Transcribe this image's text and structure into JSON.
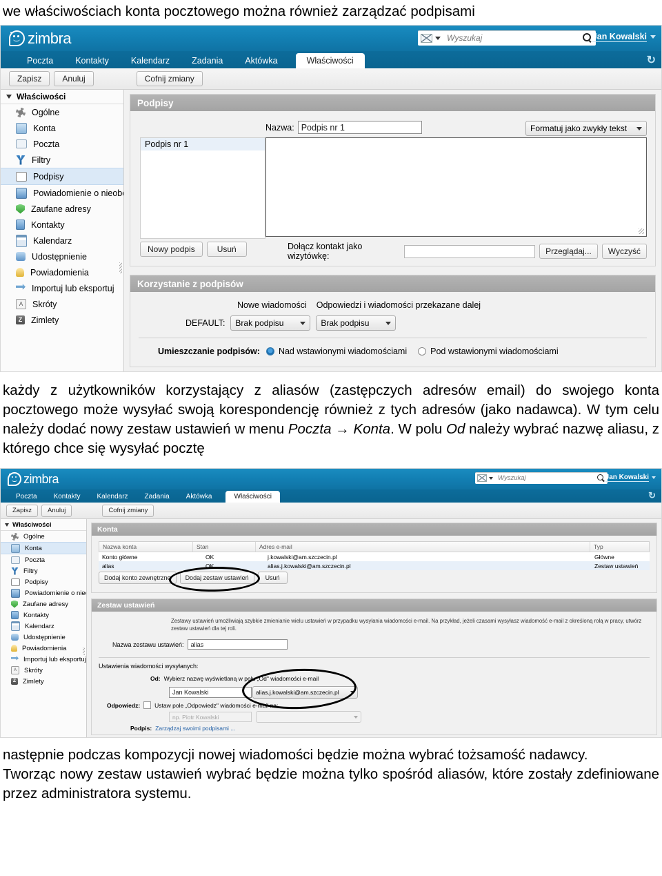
{
  "document": {
    "heading": "we właściwościach konta pocztowego można również zarządzać podpisami",
    "paragraph_middle": "każdy z użytkowników korzystający z aliasów (zastępczych adresów email) do swojego konta pocztowego może wysyłać swoją korespondencję również z tych adresów (jako nadawca). W tym celu należy dodać nowy zestaw ustawień w  menu ",
    "paragraph_middle_italic_1": "Poczta → Konta",
    "paragraph_middle_cont": ". W polu ",
    "paragraph_middle_italic_2": "Od",
    "paragraph_middle_end": " należy wybrać nazwę aliasu, z którego chce się wysyłać pocztę",
    "paragraph_bottom_1": "następnie podczas kompozycji nowej wiadomości będzie można wybrać tożsamość nadawcy.",
    "paragraph_bottom_2": "Tworząc nowy zestaw ustawień wybrać będzie można tylko spośród aliasów, które zostały zdefiniowane przez administratora systemu."
  },
  "colors": {
    "brand_blue": "#1380b4",
    "tabbar_blue": "#0a6490",
    "panel_header_gray": "#a9a9a9",
    "selected_row_blue": "#e8f0f9",
    "link_blue": "#2663a8"
  },
  "shot1": {
    "app_name": "zimbra",
    "search": {
      "placeholder": "Wyszukaj",
      "value": ""
    },
    "user": "Jan Kowalski",
    "tabs": [
      {
        "label": "Poczta",
        "active": false
      },
      {
        "label": "Kontakty",
        "active": false
      },
      {
        "label": "Kalendarz",
        "active": false
      },
      {
        "label": "Zadania",
        "active": false
      },
      {
        "label": "Aktówka",
        "active": false
      },
      {
        "label": "Właściwości",
        "active": true
      }
    ],
    "toolbar": {
      "save": "Zapisz",
      "cancel": "Anuluj",
      "undo": "Cofnij zmiany"
    },
    "sidebar": {
      "title": "Właściwości",
      "items": [
        {
          "label": "Ogólne",
          "icon": "gear-icon",
          "selected": false
        },
        {
          "label": "Konta",
          "icon": "accounts-icon",
          "selected": false
        },
        {
          "label": "Poczta",
          "icon": "mail-icon",
          "selected": false
        },
        {
          "label": "Filtry",
          "icon": "filter-icon",
          "selected": false
        },
        {
          "label": "Podpisy",
          "icon": "signature-icon",
          "selected": true
        },
        {
          "label": "Powiadomienie o nieobe",
          "icon": "out-of-office-icon",
          "selected": false
        },
        {
          "label": "Zaufane adresy",
          "icon": "shield-check-icon",
          "selected": false
        },
        {
          "label": "Kontakty",
          "icon": "lock-icon",
          "selected": false
        },
        {
          "label": "Kalendarz",
          "icon": "calendar-icon",
          "selected": false
        },
        {
          "label": "Udostępnienie",
          "icon": "share-icon",
          "selected": false
        },
        {
          "label": "Powiadomienia",
          "icon": "bell-icon",
          "selected": false
        },
        {
          "label": "Importuj lub eksportuj",
          "icon": "import-export-icon",
          "selected": false
        },
        {
          "label": "Skróty",
          "icon": "keyboard-icon",
          "selected": false
        },
        {
          "label": "Zimlety",
          "icon": "zimlet-icon",
          "selected": false
        }
      ]
    },
    "signatures_panel": {
      "title": "Podpisy",
      "list": [
        "Podpis nr 1"
      ],
      "name_label": "Nazwa:",
      "name_value": "Podpis nr 1",
      "format_select": "Formatuj jako zwykły tekst",
      "editor_value": "",
      "new_button": "Nowy podpis",
      "delete_button": "Usuń",
      "vcard_label": "Dołącz kontakt jako wizytówkę:",
      "vcard_value": "",
      "browse_button": "Przeglądaj...",
      "clear_button": "Wyczyść"
    },
    "usage_panel": {
      "title": "Korzystanie z podpisów",
      "col_new": "Nowe wiadomości",
      "col_reply": "Odpowiedzi i wiadomości przekazane dalej",
      "default_label": "DEFAULT:",
      "new_select": "Brak podpisu",
      "reply_select": "Brak podpisu",
      "placement_label": "Umieszczanie podpisów:",
      "placement_above": "Nad wstawionymi wiadomościami",
      "placement_below": "Pod wstawionymi wiadomościami",
      "placement_selected": "above"
    }
  },
  "shot2": {
    "app_name": "zimbra",
    "search": {
      "placeholder": "Wyszukaj",
      "value": ""
    },
    "user": "Jan Kowalski",
    "tabs": [
      {
        "label": "Poczta",
        "active": false
      },
      {
        "label": "Kontakty",
        "active": false
      },
      {
        "label": "Kalendarz",
        "active": false
      },
      {
        "label": "Zadania",
        "active": false
      },
      {
        "label": "Aktówka",
        "active": false
      },
      {
        "label": "Właściwości",
        "active": true
      }
    ],
    "toolbar": {
      "save": "Zapisz",
      "cancel": "Anuluj",
      "undo": "Cofnij zmiany"
    },
    "sidebar": {
      "title": "Właściwości",
      "items": [
        {
          "label": "Ogólne",
          "icon": "gear-icon",
          "selected": false
        },
        {
          "label": "Konta",
          "icon": "accounts-icon",
          "selected": true
        },
        {
          "label": "Poczta",
          "icon": "mail-icon",
          "selected": false
        },
        {
          "label": "Filtry",
          "icon": "filter-icon",
          "selected": false
        },
        {
          "label": "Podpisy",
          "icon": "signature-icon",
          "selected": false
        },
        {
          "label": "Powiadomienie o nieobe",
          "icon": "out-of-office-icon",
          "selected": false
        },
        {
          "label": "Zaufane adresy",
          "icon": "shield-check-icon",
          "selected": false
        },
        {
          "label": "Kontakty",
          "icon": "lock-icon",
          "selected": false
        },
        {
          "label": "Kalendarz",
          "icon": "calendar-icon",
          "selected": false
        },
        {
          "label": "Udostępnienie",
          "icon": "share-icon",
          "selected": false
        },
        {
          "label": "Powiadomienia",
          "icon": "bell-icon",
          "selected": false
        },
        {
          "label": "Importuj lub eksportuj",
          "icon": "import-export-icon",
          "selected": false
        },
        {
          "label": "Skróty",
          "icon": "keyboard-icon",
          "selected": false
        },
        {
          "label": "Zimlety",
          "icon": "zimlet-icon",
          "selected": false
        }
      ]
    },
    "accounts_panel": {
      "title": "Konta",
      "columns": [
        "Nazwa konta",
        "Stan",
        "Adres e-mail",
        "Typ"
      ],
      "rows": [
        {
          "name": "Konto główne",
          "state": "OK",
          "email": "j.kowalski@am.szczecin.pl",
          "type": "Główne",
          "selected": false
        },
        {
          "name": "alias",
          "state": "OK",
          "email": "alias.j.kowalski@am.szczecin.pl",
          "type": "Zestaw ustawień",
          "selected": true
        }
      ],
      "add_external_button": "Dodaj konto zewnętrzne",
      "add_persona_button": "Dodaj zestaw ustawień",
      "delete_button": "Usuń"
    },
    "persona_panel": {
      "title": "Zestaw ustawień",
      "description": "Zestawy ustawień umożliwiają szybkie zmienianie wielu ustawień w przypadku wysyłania wiadomości e-mail. Na przykład, jeżeli czasami wysyłasz wiadomość e-mail z określoną rolą w pracy, utwórz zestaw ustawień dla tej roli.",
      "name_label": "Nazwa zestawu ustawień:",
      "name_value": "alias",
      "outgoing_label": "Ustawienia wiadomości wysyłanych:",
      "from_label": "Od:",
      "from_hint": "Wybierz nazwę wyświetlaną w polu „Od\" wiadomości e-mail",
      "from_display_name": "Jan Kowalski",
      "from_address": "alias.j.kowalski@am.szczecin.pl",
      "replyto_label": "Odpowiedz:",
      "replyto_checkbox_label": "Ustaw pole „Odpowiedz\" wiadomości e-mail na:",
      "replyto_checked": false,
      "replyto_name_placeholder": "np. Piotr Kowalski",
      "replyto_address_value": "",
      "signature_label": "Podpis:",
      "signature_link": "Zarządzaj swoimi podpisami ..."
    }
  }
}
